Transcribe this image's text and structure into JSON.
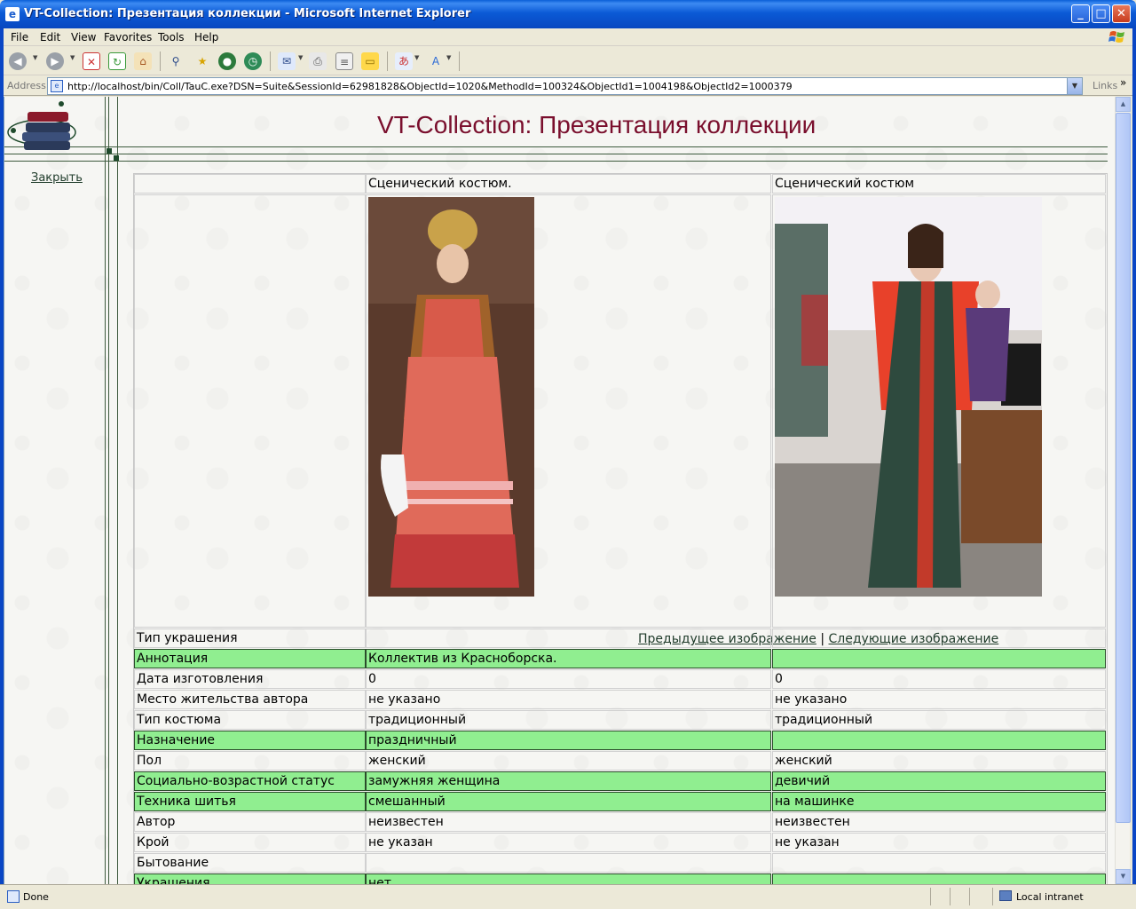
{
  "window": {
    "title": "VT-Collection: Презентация коллекции - Microsoft Internet Explorer",
    "minimize": "_",
    "maximize": "□",
    "close": "✕"
  },
  "menu": [
    "File",
    "Edit",
    "View",
    "Favorites",
    "Tools",
    "Help"
  ],
  "toolbar": {
    "icons": [
      "back-icon",
      "forward-icon",
      "stop-icon",
      "refresh-icon",
      "home-icon",
      "search-icon",
      "favorites-icon",
      "media-icon",
      "history-icon",
      "mail-icon",
      "print-icon",
      "edit-icon",
      "discuss-icon",
      "translate-icon",
      "font-icon"
    ]
  },
  "address": {
    "label": "Address",
    "url": "http://localhost/bin/Coll/TauC.exe?DSN=Suite&SessionId=62981828&ObjectId=1020&MethodId=100324&ObjectId1=1004198&ObjectId2=1000379",
    "links": "Links"
  },
  "page": {
    "title": "VT-Collection: Презентация коллекции",
    "close_link": "Закрыть",
    "header_col1": "Сценический костюм.",
    "header_col2": "Сценический костюм",
    "prev_image": "Предыдущее изображение",
    "nav_sep": "|",
    "next_image": "Следующие изображение",
    "rows": [
      {
        "label": "Тип украшения",
        "v1": "",
        "v2": "",
        "green": false
      },
      {
        "label": "Аннотация",
        "v1": "Коллектив из Красноборска.",
        "v2": "",
        "green": true
      },
      {
        "label": "Дата изготовления",
        "v1": "0",
        "v2": "0",
        "green": false
      },
      {
        "label": "Место жительства автора",
        "v1": "не указано",
        "v2": "не указано",
        "green": false
      },
      {
        "label": "Тип костюма",
        "v1": "традиционный",
        "v2": "традиционный",
        "green": false
      },
      {
        "label": "Назначение",
        "v1": "праздничный",
        "v2": "",
        "green": true
      },
      {
        "label": "Пол",
        "v1": "женский",
        "v2": "женский",
        "green": false
      },
      {
        "label": "Социально-возрастной статус",
        "v1": "замужняя женщина",
        "v2": "девичий",
        "green": true
      },
      {
        "label": "Техника шитья",
        "v1": "смешанный",
        "v2": "на машинке",
        "green": true
      },
      {
        "label": "Автор",
        "v1": "неизвестен",
        "v2": "неизвестен",
        "green": false
      },
      {
        "label": "Крой",
        "v1": "не указан",
        "v2": "не указан",
        "green": false
      },
      {
        "label": "Бытование",
        "v1": "",
        "v2": "",
        "green": false
      },
      {
        "label": "Украшения",
        "v1": "нет",
        "v2": "",
        "green": true
      }
    ]
  },
  "status": {
    "text": "Done",
    "zone": "Local intranet"
  },
  "colors": {
    "highlight_row": "#90ee90",
    "title": "#7a0f2d",
    "link": "#1f3b2a"
  }
}
